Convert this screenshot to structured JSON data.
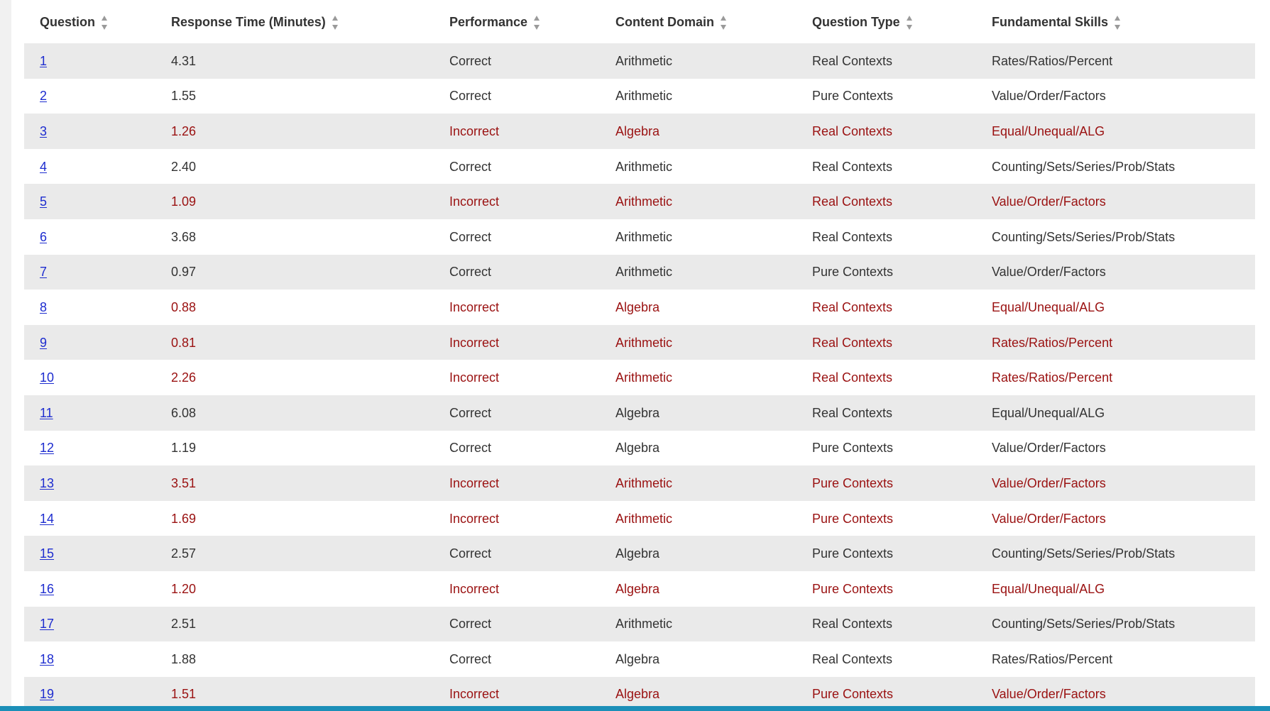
{
  "table": {
    "headers": [
      {
        "label": "Question"
      },
      {
        "label": "Response Time (Minutes)"
      },
      {
        "label": "Performance"
      },
      {
        "label": "Content Domain"
      },
      {
        "label": "Question Type"
      },
      {
        "label": "Fundamental Skills"
      }
    ],
    "rows": [
      {
        "question": "1",
        "response_time": "4.31",
        "performance": "Correct",
        "content_domain": "Arithmetic",
        "question_type": "Real Contexts",
        "fundamental_skills": "Rates/Ratios/Percent"
      },
      {
        "question": "2",
        "response_time": "1.55",
        "performance": "Correct",
        "content_domain": "Arithmetic",
        "question_type": "Pure Contexts",
        "fundamental_skills": "Value/Order/Factors"
      },
      {
        "question": "3",
        "response_time": "1.26",
        "performance": "Incorrect",
        "content_domain": "Algebra",
        "question_type": "Real Contexts",
        "fundamental_skills": "Equal/Unequal/ALG"
      },
      {
        "question": "4",
        "response_time": "2.40",
        "performance": "Correct",
        "content_domain": "Arithmetic",
        "question_type": "Real Contexts",
        "fundamental_skills": "Counting/Sets/Series/Prob/Stats"
      },
      {
        "question": "5",
        "response_time": "1.09",
        "performance": "Incorrect",
        "content_domain": "Arithmetic",
        "question_type": "Real Contexts",
        "fundamental_skills": "Value/Order/Factors"
      },
      {
        "question": "6",
        "response_time": "3.68",
        "performance": "Correct",
        "content_domain": "Arithmetic",
        "question_type": "Real Contexts",
        "fundamental_skills": "Counting/Sets/Series/Prob/Stats"
      },
      {
        "question": "7",
        "response_time": "0.97",
        "performance": "Correct",
        "content_domain": "Arithmetic",
        "question_type": "Pure Contexts",
        "fundamental_skills": "Value/Order/Factors"
      },
      {
        "question": "8",
        "response_time": "0.88",
        "performance": "Incorrect",
        "content_domain": "Algebra",
        "question_type": "Real Contexts",
        "fundamental_skills": "Equal/Unequal/ALG"
      },
      {
        "question": "9",
        "response_time": "0.81",
        "performance": "Incorrect",
        "content_domain": "Arithmetic",
        "question_type": "Real Contexts",
        "fundamental_skills": "Rates/Ratios/Percent"
      },
      {
        "question": "10",
        "response_time": "2.26",
        "performance": "Incorrect",
        "content_domain": "Arithmetic",
        "question_type": "Real Contexts",
        "fundamental_skills": "Rates/Ratios/Percent"
      },
      {
        "question": "11",
        "response_time": "6.08",
        "performance": "Correct",
        "content_domain": "Algebra",
        "question_type": "Real Contexts",
        "fundamental_skills": "Equal/Unequal/ALG"
      },
      {
        "question": "12",
        "response_time": "1.19",
        "performance": "Correct",
        "content_domain": "Algebra",
        "question_type": "Pure Contexts",
        "fundamental_skills": "Value/Order/Factors"
      },
      {
        "question": "13",
        "response_time": "3.51",
        "performance": "Incorrect",
        "content_domain": "Arithmetic",
        "question_type": "Pure Contexts",
        "fundamental_skills": "Value/Order/Factors"
      },
      {
        "question": "14",
        "response_time": "1.69",
        "performance": "Incorrect",
        "content_domain": "Arithmetic",
        "question_type": "Pure Contexts",
        "fundamental_skills": "Value/Order/Factors"
      },
      {
        "question": "15",
        "response_time": "2.57",
        "performance": "Correct",
        "content_domain": "Algebra",
        "question_type": "Pure Contexts",
        "fundamental_skills": "Counting/Sets/Series/Prob/Stats"
      },
      {
        "question": "16",
        "response_time": "1.20",
        "performance": "Incorrect",
        "content_domain": "Algebra",
        "question_type": "Pure Contexts",
        "fundamental_skills": "Equal/Unequal/ALG"
      },
      {
        "question": "17",
        "response_time": "2.51",
        "performance": "Correct",
        "content_domain": "Arithmetic",
        "question_type": "Real Contexts",
        "fundamental_skills": "Counting/Sets/Series/Prob/Stats"
      },
      {
        "question": "18",
        "response_time": "1.88",
        "performance": "Correct",
        "content_domain": "Algebra",
        "question_type": "Real Contexts",
        "fundamental_skills": "Rates/Ratios/Percent"
      },
      {
        "question": "19",
        "response_time": "1.51",
        "performance": "Incorrect",
        "content_domain": "Algebra",
        "question_type": "Pure Contexts",
        "fundamental_skills": "Value/Order/Factors"
      }
    ]
  },
  "icons": {
    "sort": "sort-icon"
  },
  "colors": {
    "text": "#333333",
    "incorrect_text": "#9a1111",
    "link": "#1d2ccf",
    "row_stripe": "#eaeaea",
    "bottom_bar": "#1c8fb8"
  }
}
